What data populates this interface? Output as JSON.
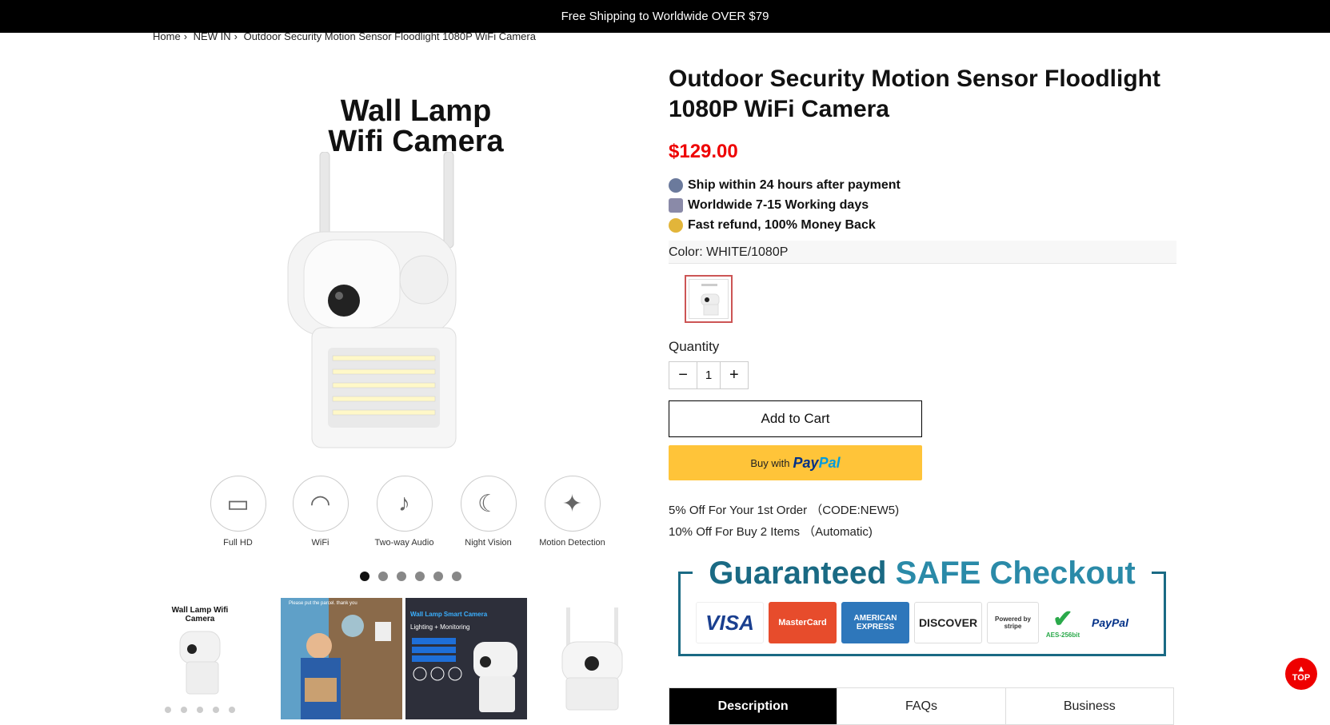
{
  "topbar": {
    "text": "Free Shipping to Worldwide OVER $79"
  },
  "breadcrumb": {
    "home": "Home",
    "sep": "›",
    "category": "NEW IN",
    "current": "Outdoor Security Motion Sensor Floodlight 1080P WiFi Camera"
  },
  "gallery": {
    "hero_title_line1": "Wall Lamp",
    "hero_title_line2": "Wifi Camera",
    "features": [
      {
        "icon": "hd-video-icon",
        "glyph": "▭",
        "label": "Full HD"
      },
      {
        "icon": "wifi-icon",
        "glyph": "◠",
        "label": "WiFi"
      },
      {
        "icon": "microphone-icon",
        "glyph": "♪",
        "label": "Two-way Audio"
      },
      {
        "icon": "moon-icon",
        "glyph": "☾",
        "label": "Night Vision"
      },
      {
        "icon": "walking-person-icon",
        "glyph": "✦",
        "label": "Motion Detection"
      }
    ],
    "slide_count": 6,
    "active_slide": 1,
    "thumbs": [
      {
        "title": "Wall Lamp Wifi Camera"
      },
      {
        "title": "Please put the parcel. thank you"
      },
      {
        "title": "Wall Lamp Smart Camera",
        "subtitle": "Lighting + Monitoring"
      },
      {
        "title": ""
      }
    ]
  },
  "product": {
    "title": "Outdoor Security Motion Sensor Floodlight 1080P WiFi Camera",
    "price": "$129.00",
    "perks": [
      {
        "icon": "delivery-truck-icon",
        "color": "#6b7a9c",
        "text": "Ship within 24 hours after payment"
      },
      {
        "icon": "shopping-cart-icon",
        "color": "#8a8aa8",
        "text": "Worldwide 7-15 Working days"
      },
      {
        "icon": "coin-icon",
        "color": "#e2b53a",
        "text": "Fast refund, 100% Money Back"
      }
    ],
    "color_label": "Color:",
    "color_value": "WHITE/1080P",
    "quantity_label": "Quantity",
    "quantity_value": "1",
    "minus": "−",
    "plus": "+",
    "add_to_cart": "Add to Cart",
    "paypal_prefix": "Buy with",
    "paypal_part1": "Pay",
    "paypal_part2": "Pal",
    "promos": [
      "5% Off For Your 1st Order （CODE:NEW5)",
      "10% Off For Buy 2 Items （Automatic)"
    ]
  },
  "safe_checkout": {
    "title_part1": "Guaranteed ",
    "title_part2": "SAFE Checkout",
    "cards": [
      {
        "name": "VISA",
        "color": "#1a3f8f",
        "width": 80
      },
      {
        "name": "MasterCard",
        "color": "#d9251d",
        "width": 80
      },
      {
        "name": "AMERICAN EXPRESS",
        "color": "#2e77bb",
        "width": 80
      },
      {
        "name": "DISCOVER",
        "color": "#f58220",
        "width": 80
      },
      {
        "name": "Powered by stripe",
        "color": "#333",
        "width": 65
      },
      {
        "name": "AES-256bit",
        "color": "#2aa94a",
        "width": 50
      },
      {
        "name": "PayPal",
        "color": "#003087",
        "width": 58
      }
    ]
  },
  "tabs": [
    {
      "label": "Description",
      "active": true
    },
    {
      "label": "FAQs",
      "active": false
    },
    {
      "label": "Business",
      "active": false
    }
  ],
  "scroll_top": {
    "label": "TOP"
  }
}
